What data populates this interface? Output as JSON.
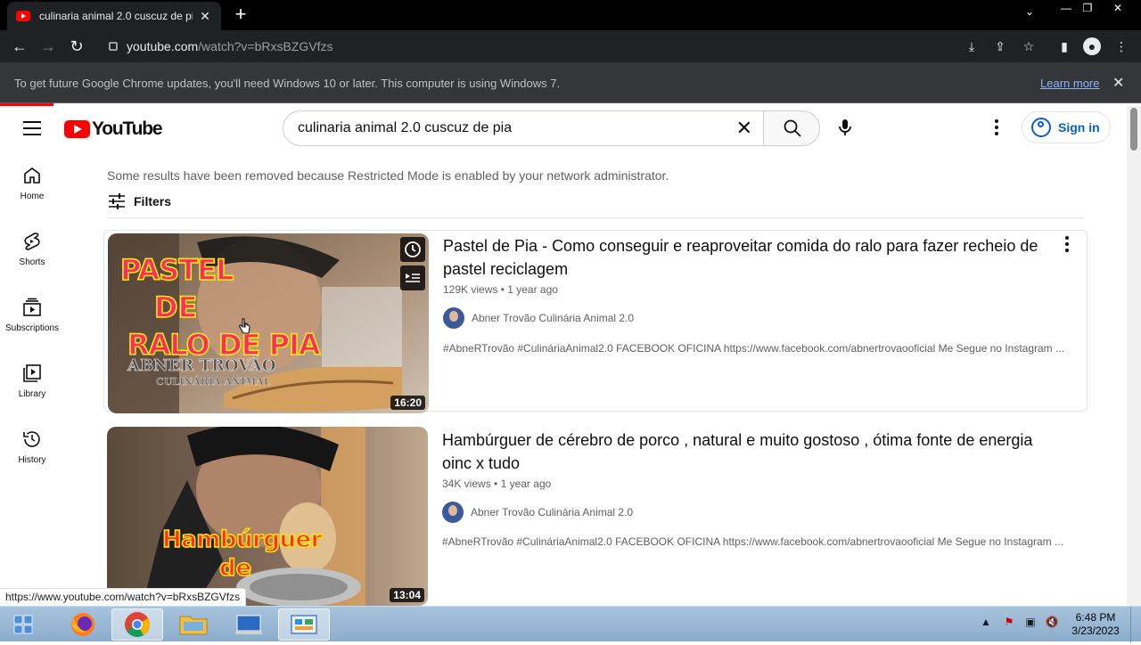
{
  "browser": {
    "tab_title": "culinaria animal 2.0 cuscuz de pia",
    "tab_close": "✕",
    "new_tab": "+",
    "window_controls": [
      "—",
      "❐",
      "✕"
    ],
    "url_host": "youtube.com",
    "url_path": "/watch?v=bRxsBZGVfzs",
    "back": "←",
    "forward": "→",
    "reload": "↻"
  },
  "infobar": {
    "message": "To get future Google Chrome updates, you'll need Windows 10 or later. This computer is using Windows 7.",
    "link": "Learn more",
    "close": "✕"
  },
  "youtube": {
    "logo_text": "YouTube",
    "search_value": "culinaria animal 2.0 cuscuz de pia",
    "search_clear": "✕",
    "sign_in": "Sign in"
  },
  "guide": [
    {
      "label": "Home",
      "icon": "home-icon"
    },
    {
      "label": "Shorts",
      "icon": "shorts-icon"
    },
    {
      "label": "Subscriptions",
      "icon": "subscriptions-icon"
    },
    {
      "label": "Library",
      "icon": "library-icon"
    },
    {
      "label": "History",
      "icon": "history-icon"
    }
  ],
  "results": {
    "restricted_notice": "Some results have been removed because Restricted Mode is enabled by your network administrator.",
    "filters_label": "Filters",
    "videos": [
      {
        "title": "Pastel de Pia - Como conseguir e reaproveitar comida do ralo para fazer recheio de pastel reciclagem",
        "views": "129K views",
        "age": "1 year ago",
        "channel": "Abner Trovão Culinária Animal 2.0",
        "description": "#AbneRTrovão #CulináriaAnimal2.0 FACEBOOK OFICINA https://www.facebook.com/abnertrovaooficial Me Segue no Instagram ...",
        "duration": "16:20",
        "thumb_lines": [
          "PASTEL",
          "DE",
          "RALO DE PIA"
        ],
        "thumb_sub": "ABNER TROVÃO",
        "thumb_sub2": "CULINÁRIA ANIMAL"
      },
      {
        "title": "Hambúrguer de cérebro de porco , natural e muito gostoso , ótima fonte de energia oinc x tudo",
        "views": "34K views",
        "age": "1 year ago",
        "channel": "Abner Trovão Culinária Animal 2.0",
        "description": "#AbneRTrovão #CulináriaAnimal2.0 FACEBOOK OFICINA https://www.facebook.com/abnertrovaooficial Me Segue no Instagram ...",
        "duration": "13:04",
        "thumb_lines": [
          "Hambúrguer",
          "de"
        ]
      }
    ]
  },
  "status_url": "https://www.youtube.com/watch?v=bRxsBZGVfzs",
  "taskbar": {
    "time": "6:48 PM",
    "date": "3/23/2023"
  },
  "colors": {
    "youtube_red": "#ff0000",
    "link_blue": "#065fd4",
    "chrome_dark": "#202124"
  }
}
